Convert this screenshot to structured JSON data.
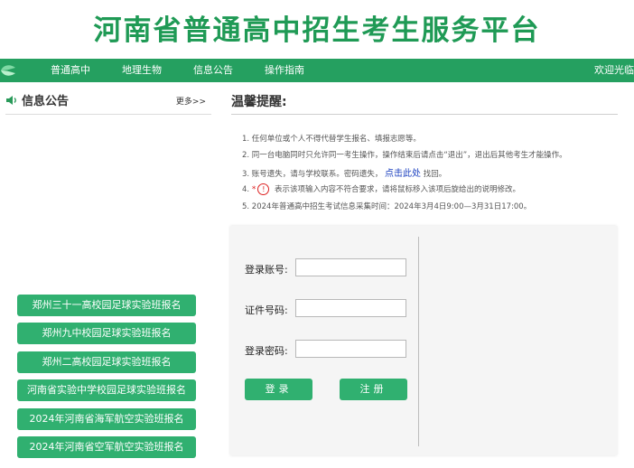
{
  "header": {
    "site_title": "河南省普通高中招生考生服务平台"
  },
  "nav": {
    "items": [
      "普通高中",
      "地理生物",
      "信息公告",
      "操作指南"
    ],
    "welcome": "欢迎光临"
  },
  "notice": {
    "title": "信息公告",
    "more": "更多>>",
    "buttons": [
      "郑州三十一高校园足球实验班报名",
      "郑州九中校园足球实验班报名",
      "郑州二高校园足球实验班报名",
      "河南省实验中学校园足球实验班报名",
      "2024年河南省海军航空实验班报名",
      "2024年河南省空军航空实验班报名"
    ]
  },
  "tips": {
    "title": "温馨提醒:",
    "items": [
      "1. 任何单位或个人不得代替学生报名、填报志愿等。",
      "2. 同一台电脑同时只允许同一考生操作，操作结束后请点击“退出”，退出后其他考生才能操作。",
      "3. 账号遗失，请与学校联系。密码遗失，",
      "4.",
      "5. 2024年普通高中招生考试信息采集时间：2024年3月4日9:00—3月31日17:00。"
    ],
    "tip3_link": "点击此处",
    "tip3_tail": "找回。",
    "tip4_mark": "*",
    "tip4_icon": "!",
    "tip4_text": "表示该项输入内容不符合要求，请将鼠标移入该项后旋给出的说明修改。"
  },
  "login": {
    "account_label": "登录账号:",
    "id_label": "证件号码:",
    "password_label": "登录密码:",
    "account_value": "",
    "id_value": "",
    "password_value": "",
    "login_button": "登录",
    "register_button": "注册"
  },
  "colors": {
    "brand": "#1f9a55",
    "nav_bg": "#25a060",
    "button": "#30b070",
    "link": "#1a3fbf",
    "warning": "#dd2222"
  }
}
